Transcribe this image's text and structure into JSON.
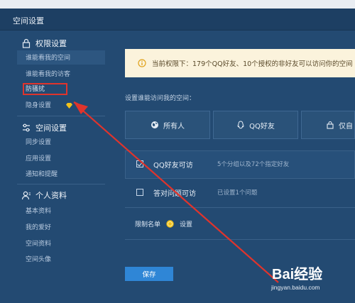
{
  "window": {
    "title": "空间设置"
  },
  "sidebar": {
    "sections": [
      {
        "title": "权限设置",
        "icon": "lock-icon",
        "items": [
          "谁能看我的空间",
          "谁能看我的访客",
          "防骚扰",
          "隐身设置"
        ]
      },
      {
        "title": "空间设置",
        "icon": "settings-icon",
        "items": [
          "同步设置",
          "应用设置",
          "通知和提醒"
        ]
      },
      {
        "title": "个人资料",
        "icon": "user-icon",
        "items": [
          "基本资料",
          "我的爱好",
          "空间资料",
          "空间头像"
        ]
      }
    ]
  },
  "main": {
    "notice": {
      "text": "当前权限下：179个QQ好友、10个授权的非好友可以访问你的空间",
      "icon": "info-icon"
    },
    "who_label": "设置谁能访问我的空间：",
    "options": [
      {
        "label": "所有人",
        "icon": "globe-icon"
      },
      {
        "label": "QQ好友",
        "icon": "qq-penguin-icon"
      },
      {
        "label": "仅自",
        "icon": "lock-icon"
      }
    ],
    "rows": [
      {
        "label": "QQ好友可访",
        "desc": "5个分组以及72个指定好友",
        "checked": true
      },
      {
        "label": "答对问题可访",
        "desc": "已设置1个问题",
        "checked": false
      }
    ],
    "limit": {
      "label": "限制名单",
      "link": "设置",
      "icon": "coin-icon"
    },
    "save_label": "保存"
  },
  "watermark": {
    "brand": "Bai经验",
    "url": "jingyan.baidu.com"
  },
  "colors": {
    "highlight": "#e0342c",
    "save": "#2f86d6",
    "notice_bg": "#fbf3dc"
  }
}
